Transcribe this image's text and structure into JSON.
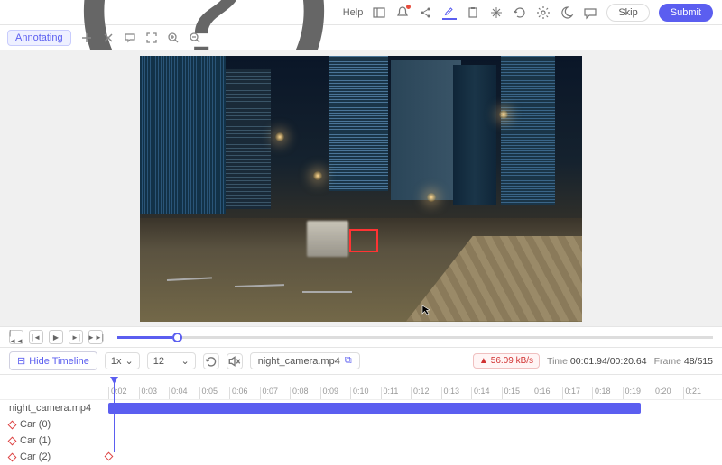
{
  "topbar": {
    "help_label": "Help",
    "skip_label": "Skip",
    "submit_label": "Submit"
  },
  "toolbar": {
    "status": "Annotating"
  },
  "playback": {
    "speed": "1x",
    "fps": "12",
    "hide_timeline_label": "Hide Timeline",
    "filename": "night_camera.mp4",
    "bitrate": "56.09 kB/s",
    "time_label": "Time",
    "time_current": "00:01.94",
    "time_total": "00:20.64",
    "frame_label": "Frame",
    "frame_current": "48",
    "frame_total": "515"
  },
  "timeline": {
    "ticks": [
      "0:02",
      "0:03",
      "0:04",
      "0:05",
      "0:06",
      "0:07",
      "0:08",
      "0:09",
      "0:10",
      "0:11",
      "0:12",
      "0:13",
      "0:14",
      "0:15",
      "0:16",
      "0:17",
      "0:18",
      "0:19",
      "0:20",
      "0:21"
    ],
    "video_track": "night_camera.mp4",
    "objects": [
      "Car (0)",
      "Car (1)",
      "Car (2)"
    ]
  }
}
